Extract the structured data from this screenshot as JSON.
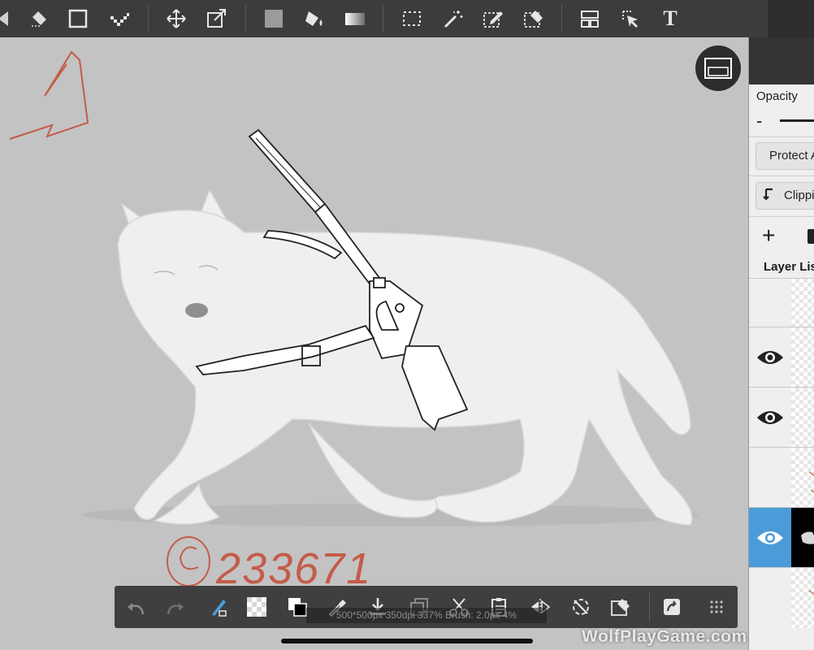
{
  "top_toolbar": {
    "tools": [
      {
        "icon": "brush-icon"
      },
      {
        "icon": "eraser-icon"
      },
      {
        "icon": "shape-icon"
      },
      {
        "icon": "dot-pen-icon"
      },
      {
        "icon": "move-icon"
      },
      {
        "icon": "transform-icon"
      },
      {
        "icon": "fill-color-icon"
      },
      {
        "icon": "bucket-icon"
      },
      {
        "icon": "gradient-icon"
      },
      {
        "icon": "select-rect-icon"
      },
      {
        "icon": "magic-wand-icon"
      },
      {
        "icon": "select-pen-icon"
      },
      {
        "icon": "select-eraser-icon"
      },
      {
        "icon": "frame-divider-icon"
      },
      {
        "icon": "operation-icon"
      },
      {
        "icon": "text-icon"
      }
    ],
    "text_tool_glyph": "T"
  },
  "canvas": {
    "signature": "©233671"
  },
  "side_panel": {
    "opacity_label": "Opacity",
    "opacity_minus": "-",
    "protect_label": "Protect Alpha",
    "clipping_label": "Clipping",
    "add_layer_glyph": "+",
    "layer_list_label": "Layer List",
    "layers": [
      {
        "visible": false,
        "selected": false
      },
      {
        "visible": true,
        "selected": false
      },
      {
        "visible": true,
        "selected": false
      },
      {
        "visible": false,
        "selected": false
      },
      {
        "visible": true,
        "selected": true
      },
      {
        "visible": false,
        "selected": false
      }
    ]
  },
  "bottom_toolbar": {
    "status": "500*500px 350dpi 337% Brush: 2.0px 4%",
    "tools": [
      {
        "icon": "undo-icon"
      },
      {
        "icon": "redo-icon"
      },
      {
        "icon": "brush-color-icon"
      },
      {
        "icon": "transparent-icon"
      },
      {
        "icon": "color-swap-icon"
      },
      {
        "icon": "eyedropper-icon"
      },
      {
        "icon": "save-icon"
      },
      {
        "icon": "copy-icon"
      },
      {
        "icon": "cut-icon"
      },
      {
        "icon": "paste-icon"
      },
      {
        "icon": "flip-icon"
      },
      {
        "icon": "rotate-icon"
      },
      {
        "icon": "clear-icon"
      },
      {
        "icon": "share-icon"
      },
      {
        "icon": "menu-grid-icon"
      }
    ]
  },
  "watermark": "WolfPlayGame.com",
  "colors": {
    "canvas_bg": "#c3c3c3",
    "toolbar_bg": "#3c3c3c",
    "selected_layer": "#4a9bd8",
    "sketch_red": "#c45c4a"
  }
}
